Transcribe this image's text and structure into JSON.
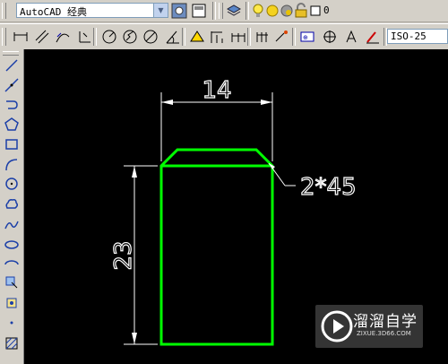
{
  "workspace": {
    "selected": "AutoCAD 经典"
  },
  "layer": {
    "current": "0"
  },
  "dimstyle": {
    "current": "ISO-25"
  },
  "drawing": {
    "dim_width": "14",
    "dim_height": "23",
    "chamfer_note": "2*45",
    "line_color": "#00ff00",
    "dim_color": "#ffffff",
    "background": "#000000"
  },
  "watermark": {
    "title": "溜溜自学",
    "url": "ZIXUE.3D66.COM"
  },
  "icons": {
    "top": [
      "workspace-settings-icon",
      "workspace-icon",
      "layer-manager-icon",
      "layer-on-icon",
      "layer-sun-icon",
      "layer-lock-icon",
      "layer-color-icon"
    ],
    "dimension": [
      "linear-dim-icon",
      "aligned-dim-icon",
      "arc-length-icon",
      "ordinate-icon",
      "radius-icon",
      "jogged-icon",
      "diameter-icon",
      "angular-icon",
      "quick-dim-icon",
      "baseline-icon",
      "continue-icon",
      "leader-icon",
      "tolerance-icon",
      "center-mark-icon",
      "dim-edit-icon",
      "dim-text-edit-icon",
      "dim-update-icon"
    ],
    "draw": [
      "line-icon",
      "construction-line-icon",
      "polyline-icon",
      "polygon-icon",
      "rectangle-icon",
      "arc-icon",
      "circle-icon",
      "revcloud-icon",
      "spline-icon",
      "ellipse-icon",
      "ellipse-arc-icon",
      "insert-block-icon",
      "make-block-icon",
      "point-icon",
      "hatch-icon"
    ]
  }
}
